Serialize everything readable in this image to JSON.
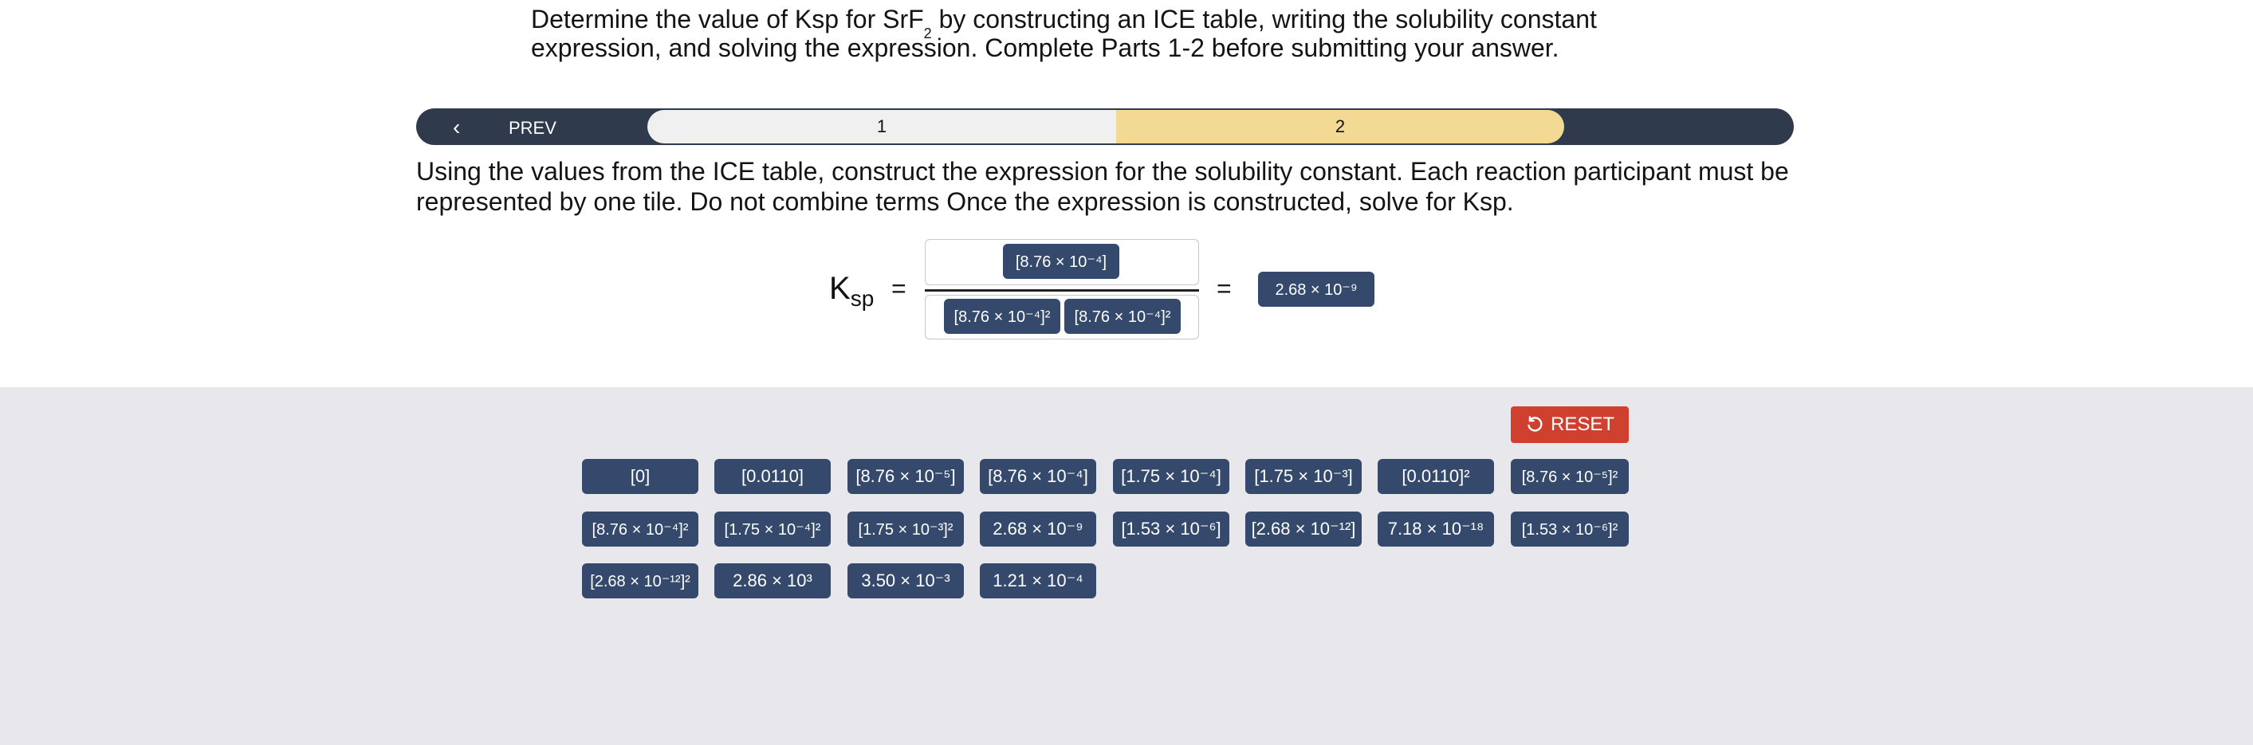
{
  "question": {
    "text_before": "Determine the value of Ksp for SrF",
    "subscript": "2",
    "text_after": " by constructing an ICE table, writing the solubility constant expression, and solving the expression. Complete Parts 1-2 before submitting your answer."
  },
  "nav": {
    "prev_label": "PREV",
    "chevron": "‹",
    "steps": [
      "1",
      "2"
    ]
  },
  "instructions": "Using the values from the ICE table, construct the expression for the solubility constant. Each reaction participant must be represented by one tile. Do not combine terms Once the expression is constructed, solve for Ksp.",
  "expression": {
    "label_main": "K",
    "label_sub": "sp",
    "equals": "=",
    "numerator_tiles": [
      "[8.76 × 10⁻⁴]"
    ],
    "denominator_tiles": [
      "[8.76 × 10⁻⁴]²",
      "[8.76 × 10⁻⁴]²"
    ],
    "result_tile": "2.68 × 10⁻⁹"
  },
  "reset_label": "RESET",
  "tile_bank": [
    [
      "[0]",
      "[0.0110]",
      "[8.76 × 10⁻⁵]",
      "[8.76 × 10⁻⁴]",
      "[1.75 × 10⁻⁴]",
      "[1.75 × 10⁻³]",
      "[0.0110]²",
      "[8.76 × 10⁻⁵]²"
    ],
    [
      "[8.76 × 10⁻⁴]²",
      "[1.75 × 10⁻⁴]²",
      "[1.75 × 10⁻³]²",
      "2.68 × 10⁻⁹",
      "[1.53 × 10⁻⁶]",
      "[2.68 × 10⁻¹²]",
      "7.18 × 10⁻¹⁸",
      "[1.53 × 10⁻⁶]²"
    ],
    [
      "[2.68 × 10⁻¹²]²",
      "2.86 × 10³",
      "3.50 × 10⁻³",
      "1.21 × 10⁻⁴"
    ]
  ],
  "colors": {
    "tile": "#34496b",
    "navbar": "#2f3a4c",
    "active_step": "#f3da94",
    "reset": "#d0402e",
    "bank_bg": "#e8e8ec"
  }
}
